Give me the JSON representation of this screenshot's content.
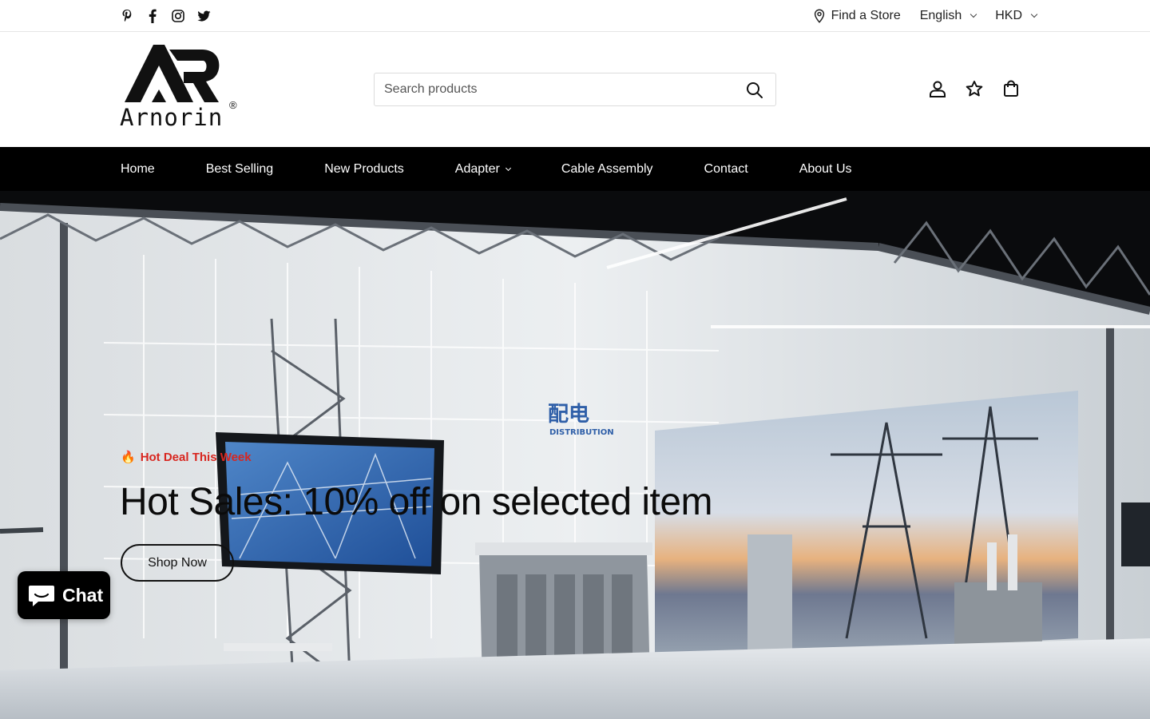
{
  "topbar": {
    "social": [
      {
        "icon": "pinterest-icon"
      },
      {
        "icon": "facebook-icon"
      },
      {
        "icon": "instagram-icon"
      },
      {
        "icon": "twitter-icon"
      }
    ],
    "find_store": "Find a Store",
    "language": "English",
    "currency": "HKD"
  },
  "header": {
    "logo_text": "Arnorin",
    "logo_reg": "®",
    "search_placeholder": "Search products",
    "icons": [
      "account-icon",
      "wishlist-star-icon",
      "cart-bag-icon"
    ]
  },
  "nav": {
    "items": [
      "Home",
      "Best Selling",
      "New Products",
      "Adapter",
      "Cable Assembly",
      "Contact",
      "About Us"
    ]
  },
  "hero": {
    "tag_emoji": "🔥",
    "tagline": "Hot Deal This Week",
    "headline": "Hot Sales: 10% off on selected item",
    "cta": "Shop Now",
    "sign_cn": "配电",
    "sign_en": "DISTRIBUTION",
    "colors": {
      "tagline": "#d8261f",
      "headline": "#0b0b0b"
    }
  },
  "chat": {
    "label": "Chat"
  }
}
